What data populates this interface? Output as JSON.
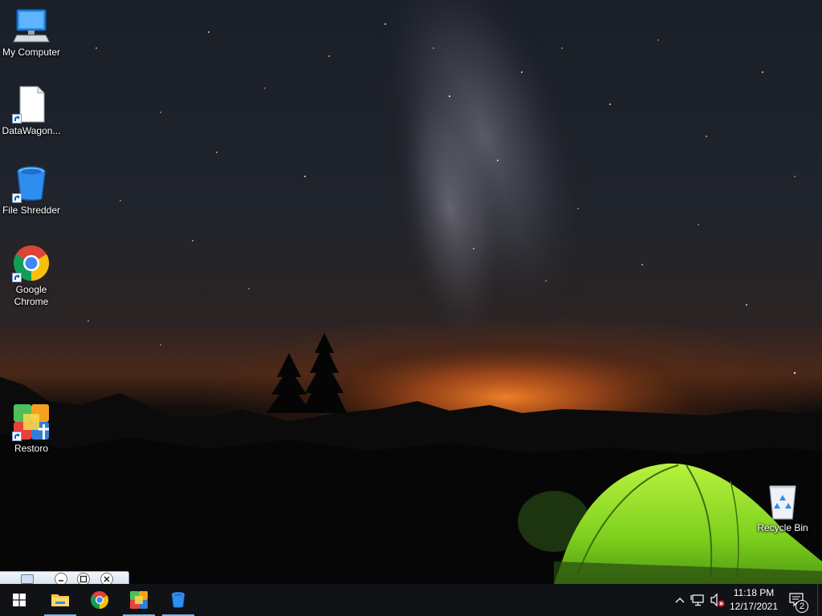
{
  "desktop": {
    "icons": [
      {
        "label": "My Computer",
        "icon": "computer-icon",
        "shortcut": false
      },
      {
        "label": "DataWagon...",
        "icon": "blank-file-icon",
        "shortcut": true
      },
      {
        "label": "File Shredder",
        "icon": "blue-bucket-icon",
        "shortcut": true
      },
      {
        "label": "Google Chrome",
        "icon": "chrome-icon",
        "shortcut": true
      },
      {
        "label": "Restoro",
        "icon": "restoro-icon",
        "shortcut": true
      },
      {
        "label": "Recycle Bin",
        "icon": "recycle-bin-icon",
        "shortcut": false
      }
    ]
  },
  "taskbar": {
    "start_icon": "windows-logo-icon",
    "pinned": [
      {
        "name": "File Explorer",
        "icon": "folder-icon",
        "active": true
      },
      {
        "name": "Google Chrome",
        "icon": "chrome-icon",
        "active": false
      },
      {
        "name": "Restoro",
        "icon": "restoro-icon",
        "active": true
      },
      {
        "name": "File Shredder",
        "icon": "blue-bucket-icon",
        "active": true
      }
    ],
    "tray": {
      "icons": [
        "chevron-up-icon",
        "network-icon",
        "volume-muted-icon"
      ],
      "time": "11:18 PM",
      "date": "12/17/2021",
      "notification_count": "2"
    }
  },
  "colors": {
    "taskbar": "#101216",
    "accent": "#7eb4ea",
    "tent_green": "#8ee02a"
  }
}
